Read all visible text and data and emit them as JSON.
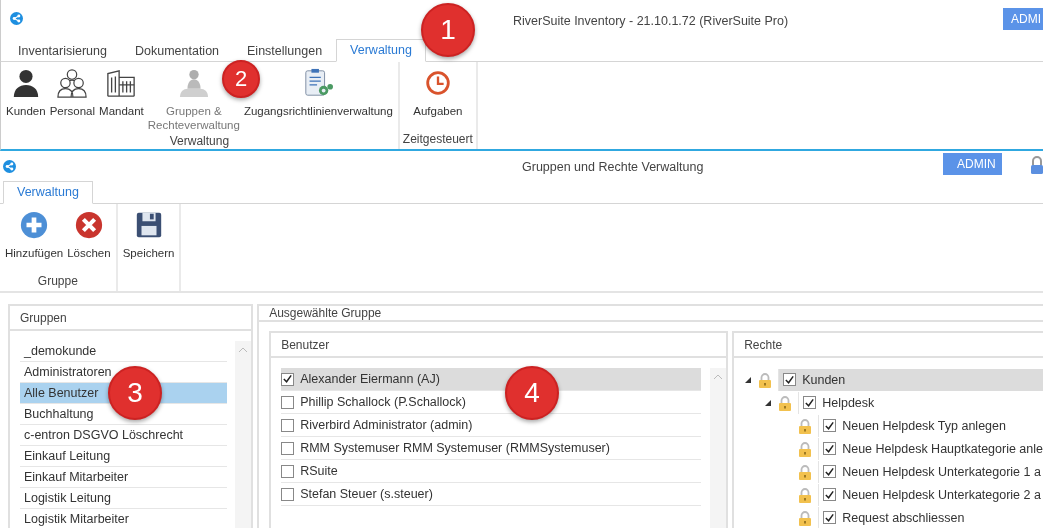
{
  "main_window": {
    "title": "RiverSuite Inventory - 21.10.1.72 (RiverSuite Pro)",
    "role_badge": "ADMI",
    "tabs": [
      {
        "label": "Inventarisierung",
        "selected": false
      },
      {
        "label": "Dokumentation",
        "selected": false
      },
      {
        "label": "Einstellungen",
        "selected": false
      },
      {
        "label": "Verwaltung",
        "selected": true
      }
    ],
    "ribbon_groups": [
      {
        "label": "Verwaltung",
        "items": [
          {
            "label": "Kunden",
            "kind": "person",
            "disabled": false
          },
          {
            "label": "Personal",
            "kind": "people",
            "disabled": false
          },
          {
            "label": "Mandant",
            "kind": "building",
            "disabled": false
          },
          {
            "label": "Gruppen &\nRechteverwaltung",
            "kind": "group",
            "disabled": true
          },
          {
            "label": "Zugangsrichtlinienverwaltung",
            "kind": "policy",
            "disabled": false
          }
        ]
      },
      {
        "label": "Zeitgesteuert",
        "items": [
          {
            "label": "Aufgaben",
            "kind": "clock",
            "disabled": false
          }
        ]
      }
    ]
  },
  "sub_window": {
    "title": "Gruppen und Rechte Verwaltung",
    "role_badge": "ADMIN",
    "tabs": [
      {
        "label": "Verwaltung",
        "selected": true
      }
    ],
    "ribbon_groups": [
      {
        "label": "Gruppe",
        "items": [
          {
            "label": "Hinzufügen",
            "kind": "add",
            "disabled": false
          },
          {
            "label": "Löschen",
            "kind": "delete",
            "disabled": false
          }
        ]
      },
      {
        "items": [
          {
            "label": "Speichern",
            "kind": "save",
            "disabled": false
          }
        ]
      }
    ]
  },
  "groups_panel": {
    "title": "Gruppen",
    "items": [
      {
        "label": "_demokunde",
        "selected": false
      },
      {
        "label": "Administratoren",
        "selected": false
      },
      {
        "label": "Alle Benutzer",
        "selected": true
      },
      {
        "label": "Buchhaltung",
        "selected": false
      },
      {
        "label": "c-entron DSGVO Löschrecht",
        "selected": false
      },
      {
        "label": "Einkauf Leitung",
        "selected": false
      },
      {
        "label": "Einkauf Mitarbeiter",
        "selected": false
      },
      {
        "label": "Logistik Leitung",
        "selected": false
      },
      {
        "label": "Logistik Mitarbeiter",
        "selected": false
      }
    ]
  },
  "selected_group_panel": {
    "title": "Ausgewählte Gruppe",
    "users": {
      "title": "Benutzer",
      "items": [
        {
          "label": "Alexander Eiermann (AJ)",
          "checked": true,
          "selected": true
        },
        {
          "label": "Phillip Schallock (P.Schallock)",
          "checked": false,
          "selected": false
        },
        {
          "label": "Riverbird Administrator (admin)",
          "checked": false,
          "selected": false
        },
        {
          "label": "RMM Systemuser RMM Systemuser (RMMSystemuser)",
          "checked": false,
          "selected": false
        },
        {
          "label": "RSuite",
          "checked": false,
          "selected": false
        },
        {
          "label": "Stefan Steuer (s.steuer)",
          "checked": false,
          "selected": false
        }
      ]
    },
    "rights": {
      "title": "Rechte",
      "items": [
        {
          "label": "Kunden",
          "checked": true,
          "selected": true,
          "expanded": true,
          "children": [
            {
              "label": "Helpdesk",
              "checked": true,
              "selected": false,
              "expanded": true,
              "children": [
                {
                  "label": "Neuen Helpdesk Typ anlegen",
                  "checked": true,
                  "selected": false
                },
                {
                  "label": "Neue Helpdesk Hauptkategorie anle",
                  "checked": true,
                  "selected": false
                },
                {
                  "label": "Neuen Helpdesk Unterkategorie 1 a",
                  "checked": true,
                  "selected": false
                },
                {
                  "label": "Neuen Helpdesk Unterkategorie 2 a",
                  "checked": true,
                  "selected": false
                },
                {
                  "label": "Request abschliessen",
                  "checked": true,
                  "selected": false
                }
              ]
            }
          ]
        }
      ]
    }
  },
  "callouts": [
    "1",
    "2",
    "3",
    "4"
  ]
}
